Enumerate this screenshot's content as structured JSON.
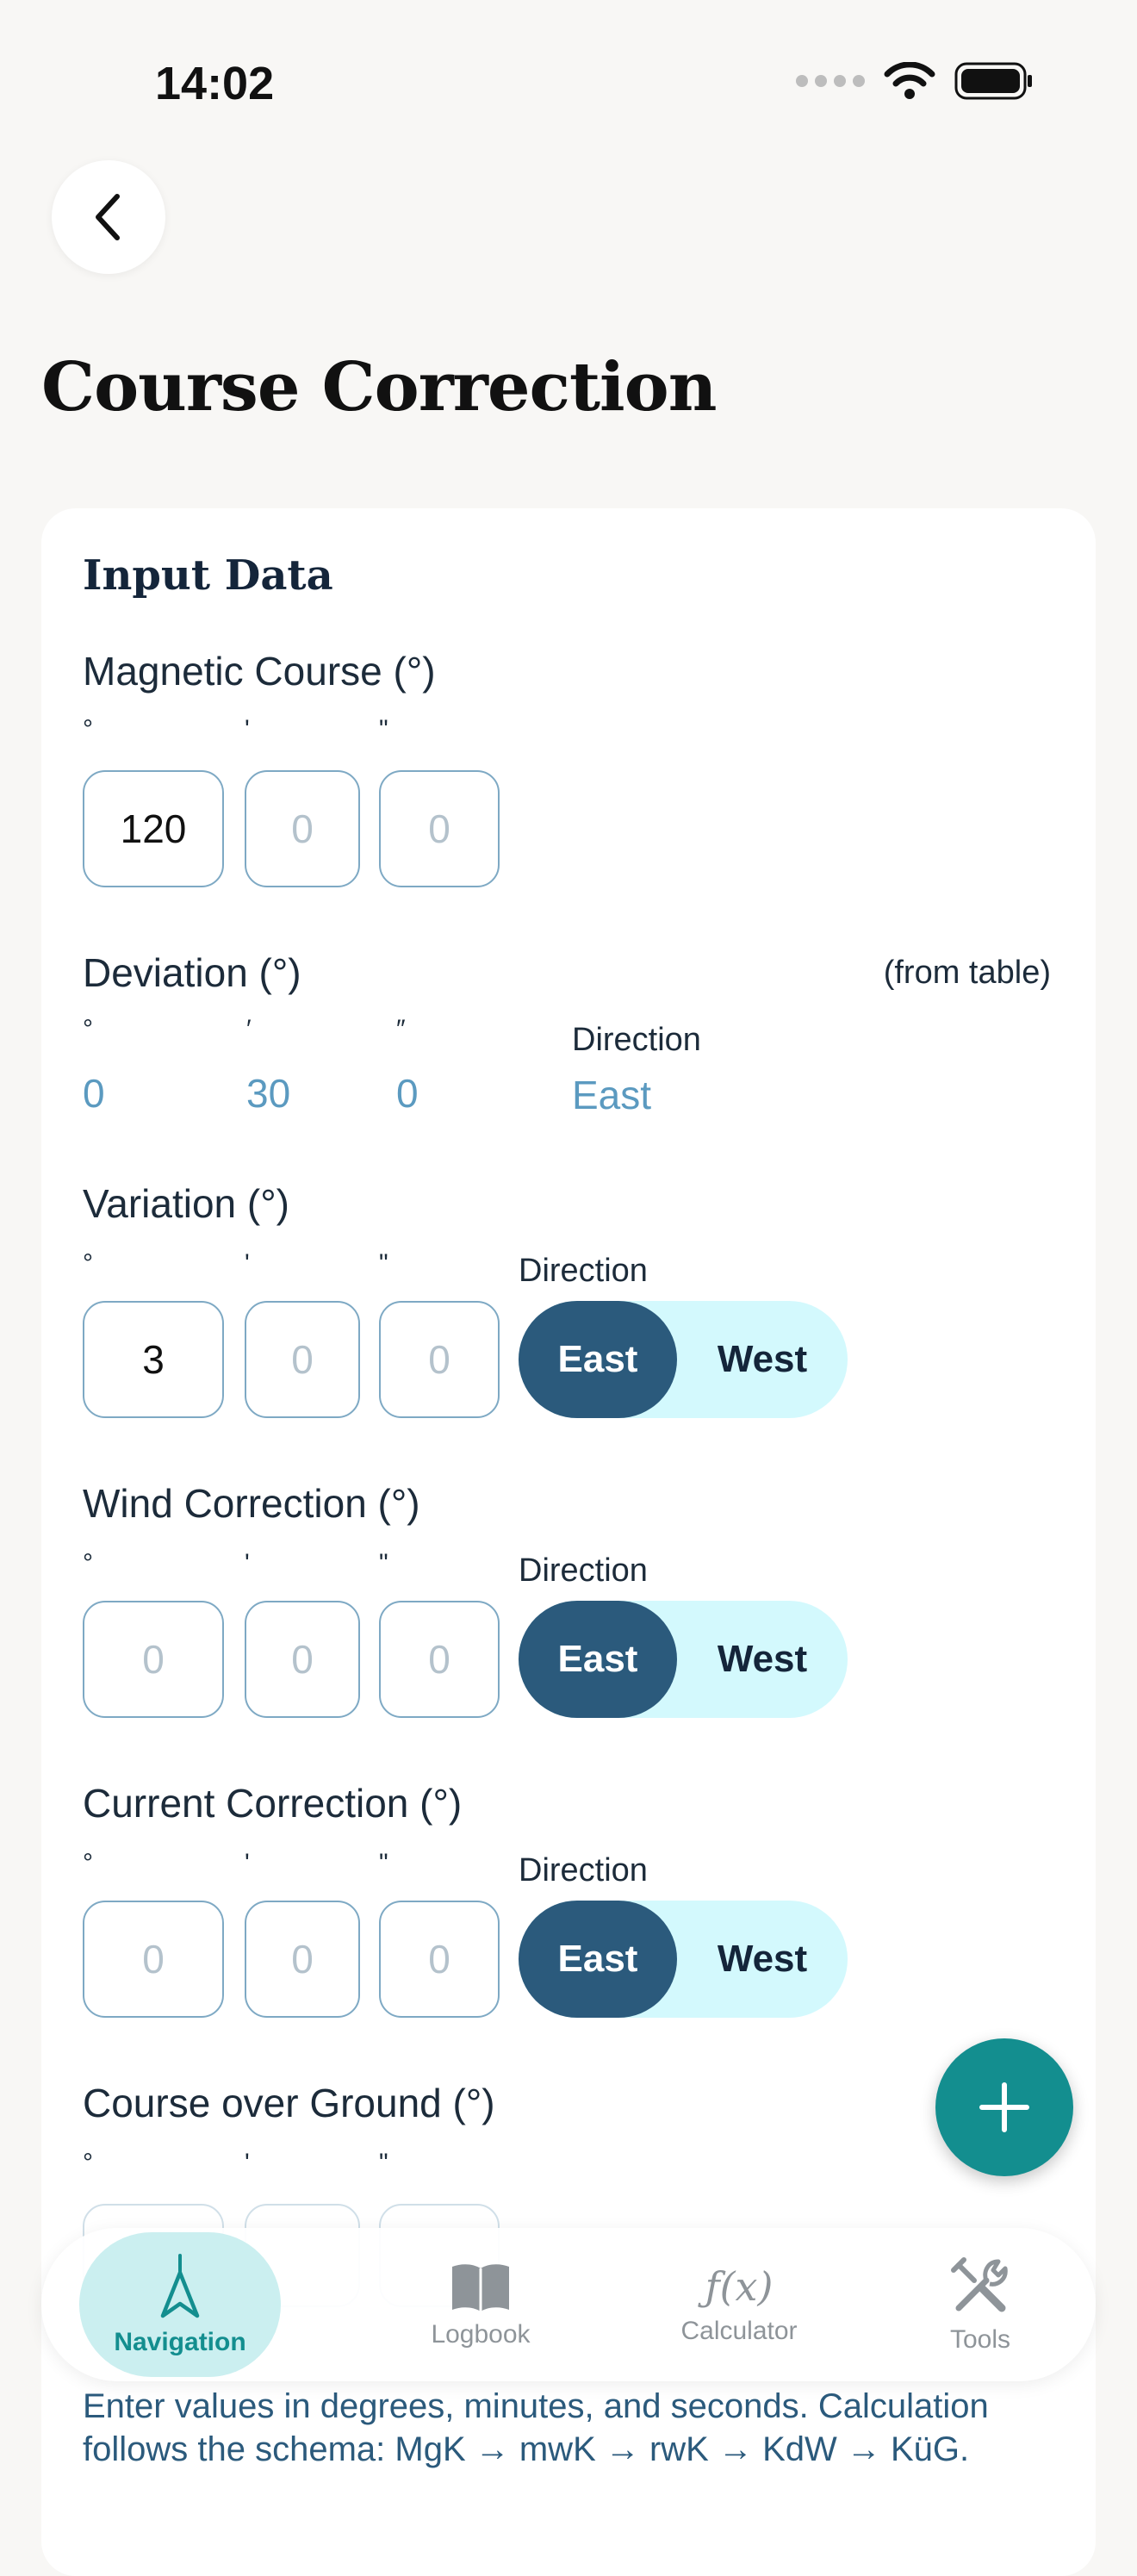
{
  "status_bar": {
    "time": "14:02"
  },
  "page": {
    "title": "Course Correction"
  },
  "section": {
    "title": "Input Data"
  },
  "units": {
    "deg": "°",
    "min": "'",
    "sec": "\"",
    "min_alt": "′",
    "sec_alt": "″"
  },
  "direction_label": "Direction",
  "magnetic_course": {
    "label": "Magnetic Course (°)",
    "deg": "120",
    "min_placeholder": "0",
    "sec_placeholder": "0"
  },
  "deviation": {
    "label": "Deviation (°)",
    "note": "(from table)",
    "deg": "0",
    "min": "30",
    "sec": "0",
    "direction": "East"
  },
  "variation": {
    "label": "Variation (°)",
    "deg": "3",
    "min_placeholder": "0",
    "sec_placeholder": "0",
    "east": "East",
    "west": "West"
  },
  "wind_correction": {
    "label": "Wind Correction (°)",
    "deg_placeholder": "0",
    "min_placeholder": "0",
    "sec_placeholder": "0",
    "east": "East",
    "west": "West"
  },
  "current_correction": {
    "label": "Current Correction (°)",
    "deg_placeholder": "0",
    "min_placeholder": "0",
    "sec_placeholder": "0",
    "east": "East",
    "west": "West"
  },
  "course_over_ground": {
    "label": "Course over Ground (°)"
  },
  "bottom_nav": {
    "navigation": "Navigation",
    "logbook": "Logbook",
    "calculator": "Calculator",
    "calculator_glyph": "ƒ(x)",
    "tools": "Tools"
  },
  "footer": {
    "note": "Enter values in degrees, minutes, and seconds. Calculation follows the schema: MgK → mwK → rwK → KdW → KüG."
  },
  "colors": {
    "accent_teal": "#138e8f",
    "toggle_active": "#2b5a7c",
    "toggle_bg": "#d3f9fd",
    "readonly_blue": "#5b9ac0"
  }
}
